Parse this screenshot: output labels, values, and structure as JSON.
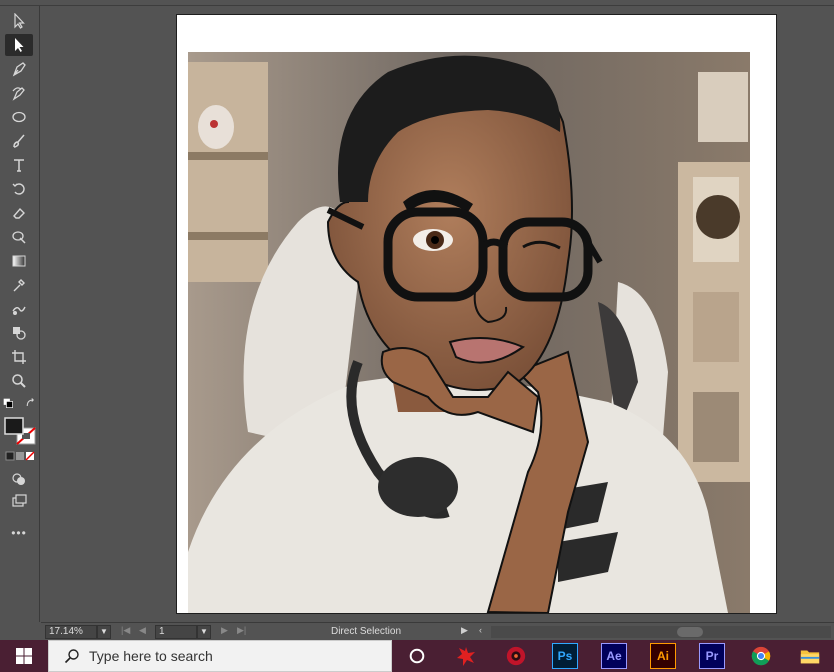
{
  "app": {
    "status_tool": "Direct Selection",
    "zoom": "17.14%",
    "page": "1"
  },
  "toolbar": {
    "tools": [
      {
        "name": "selection-tool-icon",
        "active": false
      },
      {
        "name": "direct-selection-tool-icon",
        "active": true
      },
      {
        "name": "pen-tool-icon",
        "active": false
      },
      {
        "name": "curvature-tool-icon",
        "active": false
      },
      {
        "name": "ellipse-tool-icon",
        "active": false
      },
      {
        "name": "paintbrush-tool-icon",
        "active": false
      },
      {
        "name": "type-tool-icon",
        "active": false
      },
      {
        "name": "rotate-tool-icon",
        "active": false
      },
      {
        "name": "eraser-tool-icon",
        "active": false
      },
      {
        "name": "puppet-warp-tool-icon",
        "active": false
      },
      {
        "name": "gradient-tool-icon",
        "active": false
      },
      {
        "name": "eyedropper-tool-icon",
        "active": false
      },
      {
        "name": "blend-tool-icon",
        "active": false
      },
      {
        "name": "shape-builder-tool-icon",
        "active": false
      },
      {
        "name": "artboard-tool-icon",
        "active": false
      },
      {
        "name": "zoom-tool-icon",
        "active": false
      }
    ],
    "fill_color": "#1a1a1a",
    "stroke_color": "none",
    "more_label": "•••"
  },
  "search": {
    "placeholder": "Type here to search"
  },
  "taskbar": {
    "apps": [
      {
        "name": "cortana-icon"
      },
      {
        "name": "red-app-icon"
      },
      {
        "name": "davinci-resolve-icon"
      },
      {
        "name": "photoshop-icon",
        "label": "Ps",
        "bg": "#001e36",
        "fg": "#31a8ff"
      },
      {
        "name": "after-effects-icon",
        "label": "Ae",
        "bg": "#00005b",
        "fg": "#9999ff"
      },
      {
        "name": "illustrator-icon",
        "label": "Ai",
        "bg": "#330000",
        "fg": "#ff9a00"
      },
      {
        "name": "premiere-icon",
        "label": "Pr",
        "bg": "#00005b",
        "fg": "#9999ff"
      },
      {
        "name": "chrome-icon"
      },
      {
        "name": "file-explorer-icon"
      }
    ]
  }
}
